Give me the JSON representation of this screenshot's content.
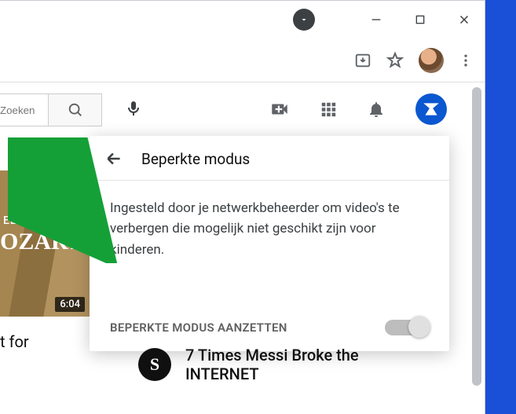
{
  "window": {
    "circle_dropdown": "dropdown"
  },
  "browser": {
    "install_tooltip": "Install",
    "star_tooltip": "Bookmark",
    "menu_tooltip": "Menu"
  },
  "youtube_header": {
    "search_placeholder": "Zoeken",
    "mic": "voice-search",
    "create": "create",
    "apps": "apps",
    "notifications": "notifications"
  },
  "popup": {
    "title": "Beperkte modus",
    "description": "Ingesteld door je netwerkbeheerder om video's te verbergen die mogelijk niet geschikt zijn voor kinderen.",
    "toggle_label": "BEPERKTE MODUS AANZETTEN",
    "toggle_on": false
  },
  "video_left": {
    "overlay_line1": "ELAX WITH",
    "overlay_line2": "OZART",
    "duration": "6:04",
    "title_fragment": "t for"
  },
  "recommendation": {
    "channel_letter": "S",
    "title_line1": "7 Times Messi Broke the",
    "title_line2_fragment": "INTERNET"
  }
}
